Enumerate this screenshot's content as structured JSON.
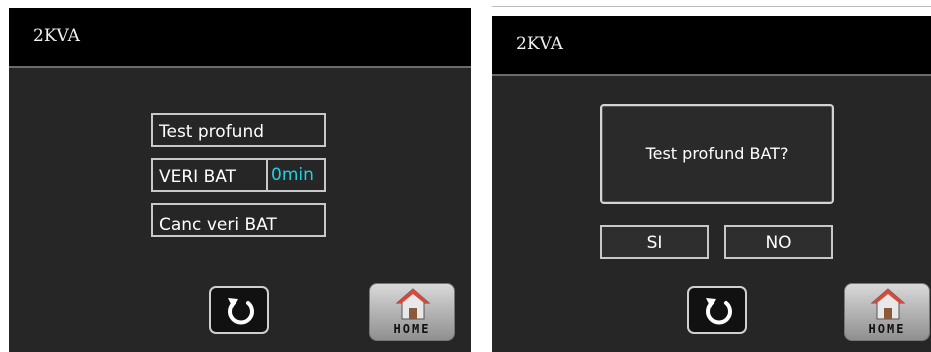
{
  "left_screen": {
    "title": "2KVA",
    "buttons": {
      "deep_test": "Test profund",
      "veri_bat": "VERI BAT",
      "veri_bat_value": "0min",
      "cancel_veri": "Canc veri BAT"
    },
    "home_label": "HOME"
  },
  "right_screen": {
    "title": "2KVA",
    "dialog_message": "Test profund BAT?",
    "yes_label": "SI",
    "no_label": "NO",
    "home_label": "HOME"
  },
  "colors": {
    "screen_bg": "#262626",
    "title_bg": "#000000",
    "value_accent": "#22d0e0"
  },
  "icons": [
    "refresh-icon",
    "home-icon"
  ]
}
